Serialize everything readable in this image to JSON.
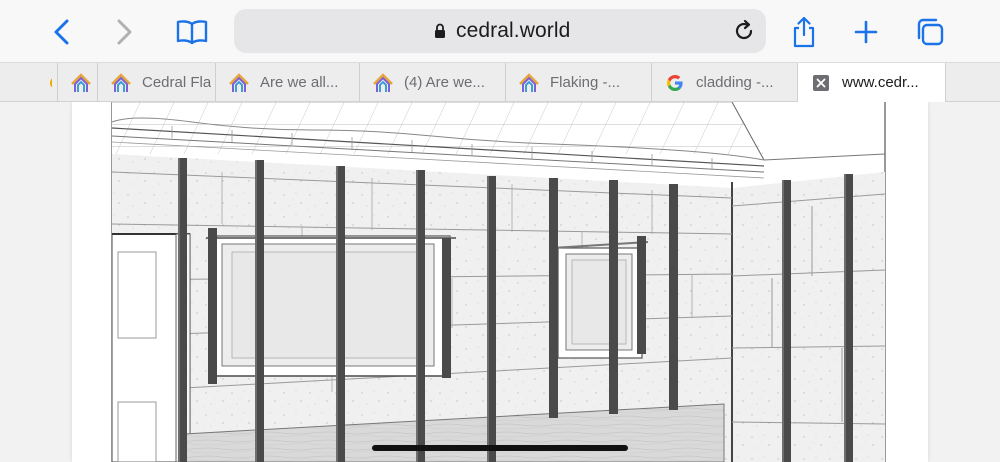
{
  "browser": {
    "toolbar": {
      "back_icon": "chevron-left",
      "forward_icon": "chevron-right",
      "bookmarks_icon": "open-book",
      "share_icon": "share-up",
      "new_tab_icon": "plus",
      "tabs_icon": "stacked-squares",
      "reload_icon": "reload-arrow"
    },
    "address_bar": {
      "url": "cedral.world",
      "secure": true
    }
  },
  "tabs": [
    {
      "title": "",
      "favicon": "partial-house-logo",
      "active": false
    },
    {
      "title": "",
      "favicon": "house-logo",
      "active": false
    },
    {
      "title": "Cedral Fla",
      "favicon": "house-logo",
      "active": false
    },
    {
      "title": "Are we all...",
      "favicon": "house-logo",
      "active": false
    },
    {
      "title": "(4) Are we...",
      "favicon": "house-logo",
      "active": false
    },
    {
      "title": "Flaking -...",
      "favicon": "house-logo",
      "active": false
    },
    {
      "title": "cladding -...",
      "favicon": "google-logo",
      "active": false
    },
    {
      "title": "www.cedr...",
      "favicon": "close",
      "active": true
    }
  ],
  "content": {
    "image": "cladding-battens-installation-drawing"
  },
  "colors": {
    "accent": "#1a73e8",
    "toolbar_bg": "#f8f8f8",
    "tabbar_bg": "#ededee",
    "address_bg": "#e6e6e9"
  }
}
